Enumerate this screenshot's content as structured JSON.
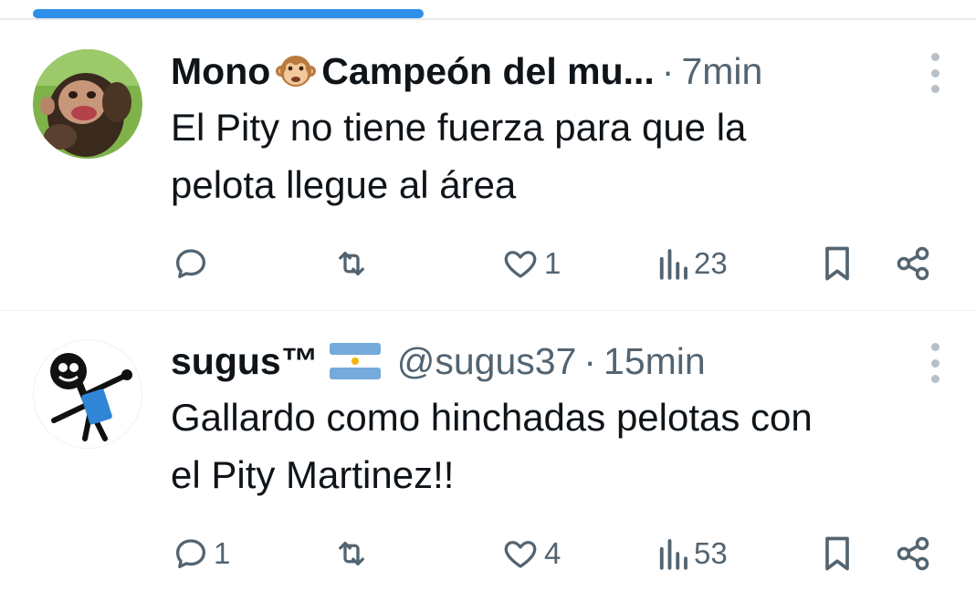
{
  "loading": {
    "progress": 0.4
  },
  "tweets": [
    {
      "name": "Mono",
      "name_suffix": "Campeón del mu...",
      "handle": "",
      "dot": "·",
      "time": "7min",
      "text_line1": "El Pity no tiene fuerza para que la",
      "text_line2": "pelota llegue al área",
      "replies": "",
      "retweets": "",
      "likes": "1",
      "views": "23"
    },
    {
      "name": "sugus™",
      "name_suffix": "",
      "handle": "@sugus37",
      "dot": "·",
      "time": "15min",
      "text_line1": "Gallardo como hinchadas pelotas con",
      "text_line2": "el Pity Martinez!!",
      "replies": "1",
      "retweets": "",
      "likes": "4",
      "views": "53"
    }
  ],
  "icons": {
    "name_emoji": "monkey-face-icon",
    "flag_emoji": "argentina-flag-icon",
    "reply": "reply-icon",
    "retweet": "retweet-icon",
    "like": "heart-icon",
    "views": "views-icon",
    "bookmark": "bookmark-icon",
    "share": "share-icon",
    "more": "more-options-icon"
  },
  "colors": {
    "accent": "#2e90e8",
    "text": "#0f1419",
    "muted": "#536471"
  }
}
